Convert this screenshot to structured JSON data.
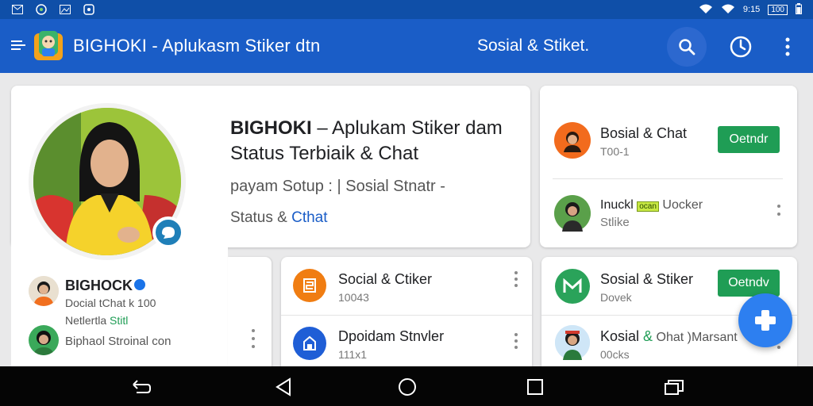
{
  "status_bar": {
    "left_icons": [
      "mail-icon",
      "clock-icon",
      "photo-icon",
      "notification-icon"
    ],
    "time_text": "9:15",
    "battery_text": "100"
  },
  "app_bar": {
    "title": "BIGHOKI - Aplukasm Stiker  dtn",
    "subtitle": "Sosial & Stiket.",
    "color": "#1a5dc7"
  },
  "hero": {
    "headline_bold": "BIGHOKI",
    "headline_rest": " – Aplukam Stiker dam Status Terbiaik & Chat",
    "meta_line1": "payam Sotup : | Sosial Stnatr  -",
    "meta_line2_prefix": "Status & ",
    "meta_line2_accent": "Cthat"
  },
  "profile": {
    "name": "BIGHOCK",
    "line1": "Docial tChat k 100",
    "line2_prefix": "Netlertla ",
    "line2_badge": "Stitl",
    "friend_label": "Biphaol Stroinal con"
  },
  "top_right_list": [
    {
      "title": "Bosial & Chat",
      "sub": "T00-1",
      "button": "Oetndr"
    },
    {
      "title": "Inuckl",
      "badge": "ocan",
      "title_rest": " Uocker",
      "sub": "Stlike"
    }
  ],
  "middle_list": [
    {
      "title": "Social & Ctiker",
      "sub": "10043"
    },
    {
      "title": "Dpoidam Stnvler",
      "sub": "111x1"
    }
  ],
  "right_list": [
    {
      "title": "Sosial & Stiker",
      "sub": "Dovek",
      "button": "Oetndv"
    },
    {
      "title_prefix": "Kosial ",
      "title_accent": "&",
      "title_rest": " Ohat )Marsant",
      "sub": "00cks"
    }
  ],
  "nav": [
    "back-icon",
    "home-icon",
    "recents-icon",
    "overview-icon"
  ],
  "colors": {
    "accent_blue": "#1a5dc7",
    "action_green": "#1f9d55",
    "fab_blue": "#2d7ff0"
  }
}
